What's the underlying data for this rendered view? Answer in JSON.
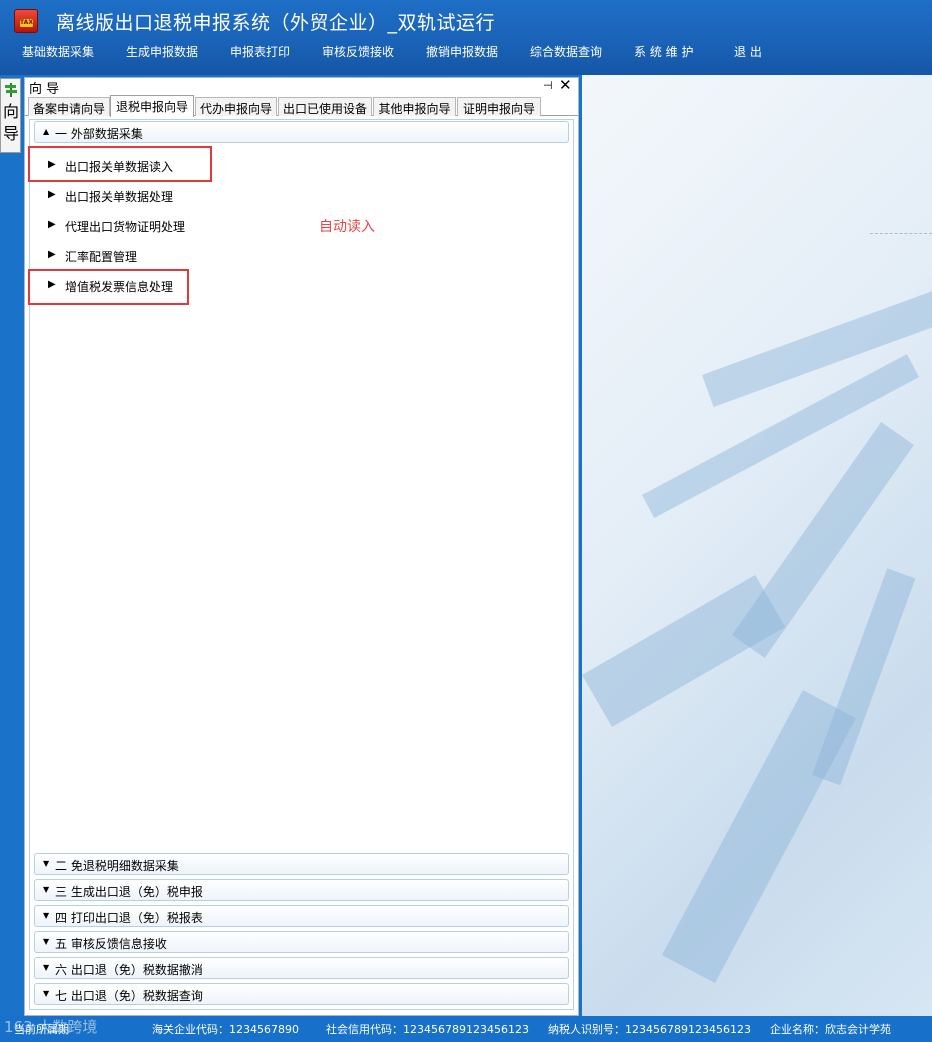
{
  "app": {
    "title": "离线版出口退税申报系统（外贸企业）_双轨试运行",
    "logo_text": "TAX"
  },
  "menu": [
    "基础数据采集",
    "生成申报数据",
    "申报表打印",
    "审核反馈接收",
    "撤销申报数据",
    "综合数据查询",
    "系 统 维 护",
    "退  出"
  ],
  "side_tab": {
    "label_line1": "向",
    "label_line2": "导"
  },
  "guide": {
    "title": "向 导",
    "pin_glyph": "⊣",
    "close_glyph": "✕",
    "tabs": [
      {
        "label": "备案申请向导",
        "active": false
      },
      {
        "label": "退税申报向导",
        "active": true
      },
      {
        "label": "代办申报向导",
        "active": false
      },
      {
        "label": "出口已使用设备",
        "active": false
      },
      {
        "label": "其他申报向导",
        "active": false
      },
      {
        "label": "证明申报向导",
        "active": false
      }
    ],
    "expanded_group": {
      "label": "一  外部数据采集",
      "items": [
        "出口报关单数据读入",
        "出口报关单数据处理",
        "代理出口货物证明处理",
        "汇率配置管理",
        "增值税发票信息处理"
      ]
    },
    "collapsed_groups": [
      "二  免退税明细数据采集",
      "三  生成出口退（免）税申报",
      "四  打印出口退（免）税报表",
      "五  审核反馈信息接收",
      "六  出口退（免）税数据撤消",
      "七  出口退（免）税数据查询"
    ],
    "annotation": "自动读入"
  },
  "status": {
    "watermark": "163 大数跨境",
    "current_user": "当前所属期",
    "customs_code": "海关企业代码：1234567890",
    "credit_code": "社会信用代码：123456789123456123",
    "taxpayer_id": "纳税人识别号：123456789123456123",
    "company_name": "企业名称：欣志会计学苑"
  },
  "colors": {
    "title_bar": "#1a63b8",
    "status_bar": "#1770c9",
    "highlight": "#e03a3a",
    "annotation": "#e64545"
  }
}
